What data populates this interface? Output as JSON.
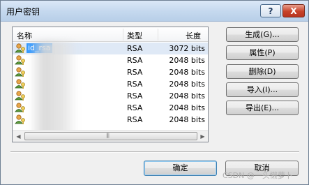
{
  "window": {
    "title": "用户密钥",
    "help_glyph": "?",
    "close_glyph": "X"
  },
  "list": {
    "columns": {
      "name": "名称",
      "type": "类型",
      "length": "长度"
    },
    "rows": [
      {
        "name": "id_rsa",
        "type": "RSA",
        "length": "3072 bits",
        "selected": true
      },
      {
        "name": "",
        "type": "RSA",
        "length": "2048 bits"
      },
      {
        "name": "",
        "type": "RSA",
        "length": "2048 bits"
      },
      {
        "name": "",
        "type": "RSA",
        "length": "2048 bits"
      },
      {
        "name": "",
        "type": "RSA",
        "length": "2048 bits"
      },
      {
        "name": "",
        "type": "RSA",
        "length": "2048 bits"
      },
      {
        "name": "",
        "type": "RSA",
        "length": "2048 bits"
      }
    ],
    "key_icon": "user-key-icon"
  },
  "side_buttons": {
    "generate": "生成(G)...",
    "properties": "属性(P)",
    "delete": "删除(D)",
    "import": "导入(I)...",
    "export": "导出(E)..."
  },
  "bottom_buttons": {
    "ok": "确定",
    "cancel": "取消"
  },
  "watermark": "CSDN @一头懒萝卜",
  "colors": {
    "selection": "#3399ff",
    "close_button": "#c7432a"
  }
}
